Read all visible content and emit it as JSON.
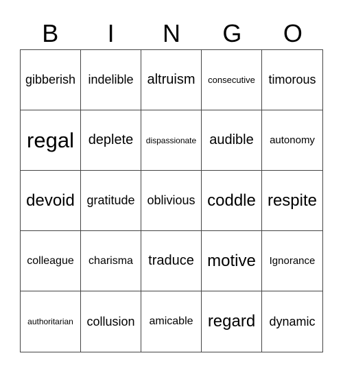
{
  "header": {
    "letters": [
      "B",
      "I",
      "N",
      "G",
      "O"
    ]
  },
  "card": {
    "rows": [
      [
        "gibberish",
        "indelible",
        "altruism",
        "consecutive",
        "timorous"
      ],
      [
        "regal",
        "deplete",
        "dispassionate",
        "audible",
        "autonomy"
      ],
      [
        "devoid",
        "gratitude",
        "oblivious",
        "coddle",
        "respite"
      ],
      [
        "colleague",
        "charisma",
        "traduce",
        "motive",
        "Ignorance"
      ],
      [
        "authoritarian",
        "collusion",
        "amicable",
        "regard",
        "dynamic"
      ]
    ]
  }
}
